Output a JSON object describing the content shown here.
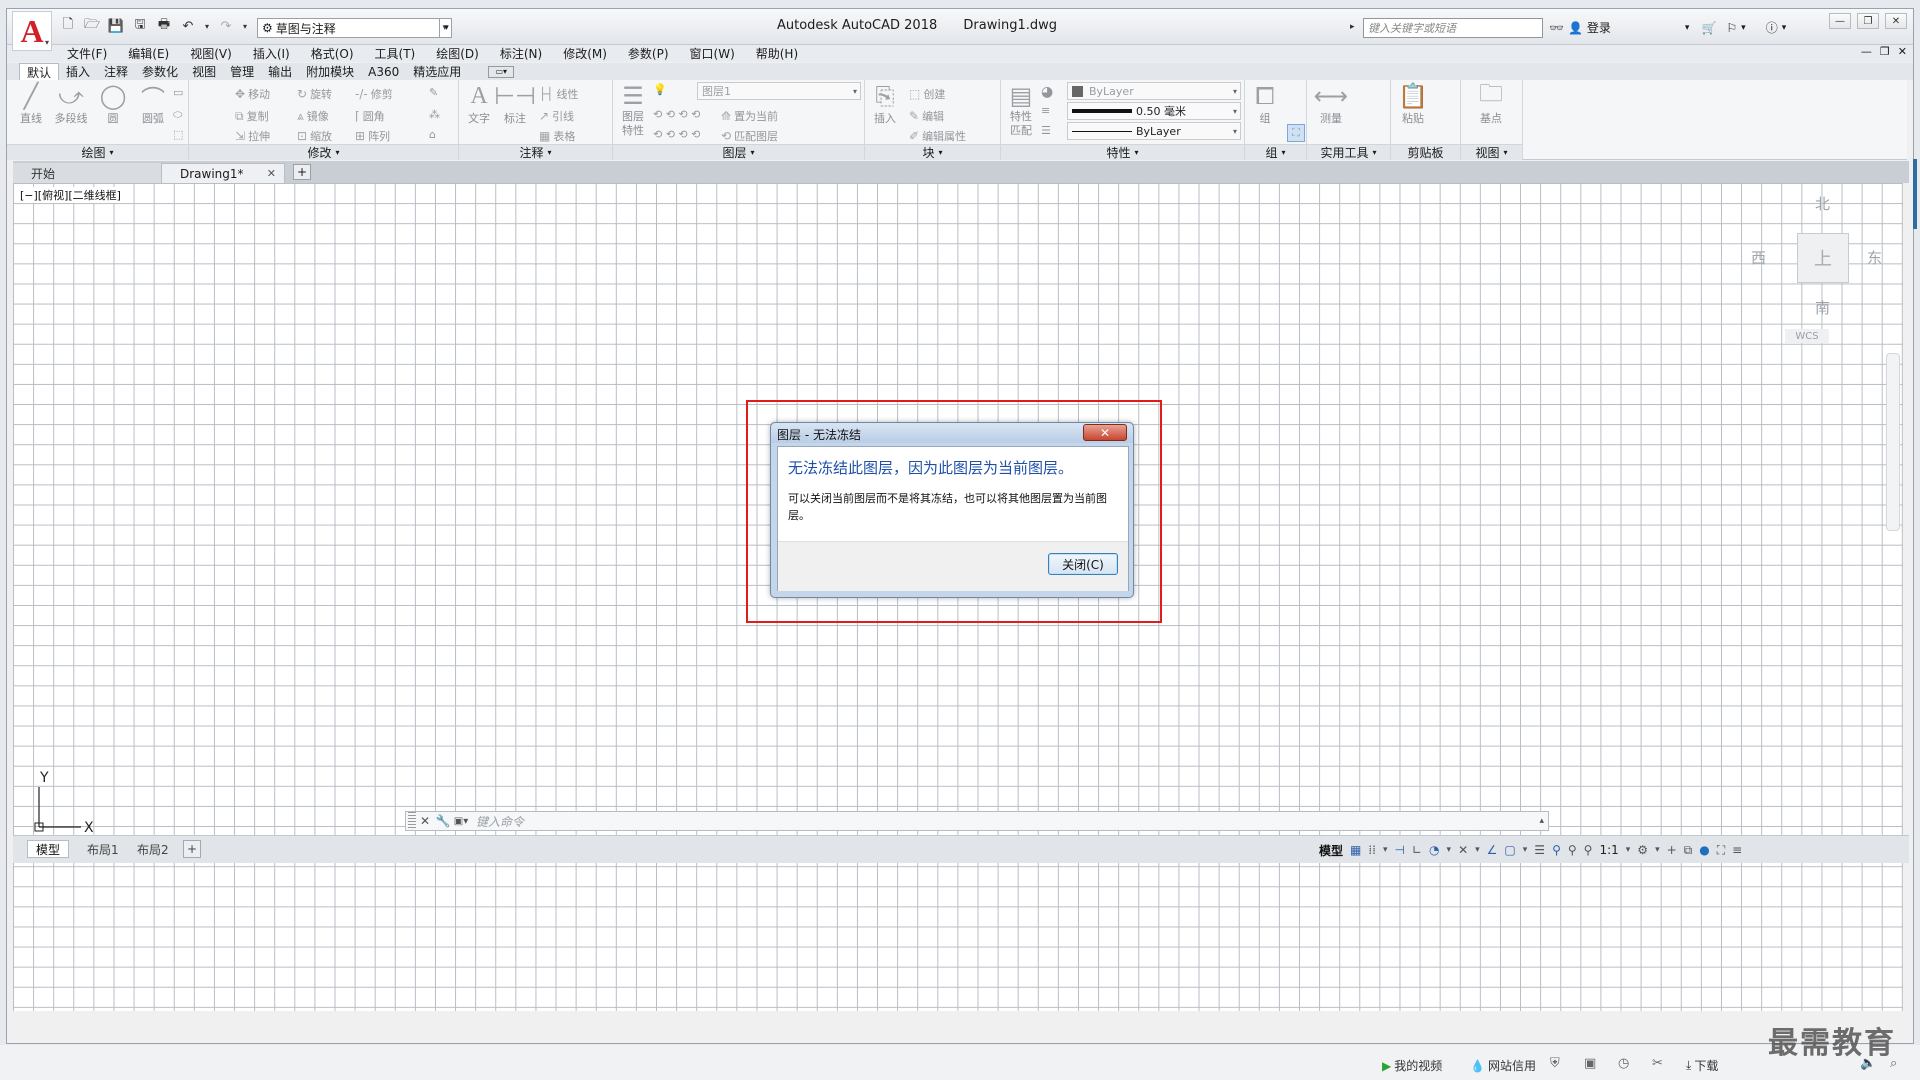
{
  "titlebar": {
    "app_name": "Autodesk AutoCAD 2018",
    "file_name": "Drawing1.dwg",
    "workspace": "草图与注释",
    "search_placeholder": "键入关键字或短语",
    "login": "登录",
    "logo_letter": "A"
  },
  "menubar": {
    "items": [
      "文件(F)",
      "编辑(E)",
      "视图(V)",
      "插入(I)",
      "格式(O)",
      "工具(T)",
      "绘图(D)",
      "标注(N)",
      "修改(M)",
      "参数(P)",
      "窗口(W)",
      "帮助(H)"
    ]
  },
  "ribbon_tabs": [
    "默认",
    "插入",
    "注释",
    "参数化",
    "视图",
    "管理",
    "输出",
    "附加模块",
    "A360",
    "精选应用"
  ],
  "ribbon": {
    "draw": {
      "title": "绘图",
      "tools": [
        "直线",
        "多段线",
        "圆",
        "圆弧"
      ]
    },
    "modify": {
      "title": "修改",
      "tools": [
        "移动",
        "旋转",
        "修剪",
        "复制",
        "镜像",
        "圆角",
        "拉伸",
        "缩放",
        "阵列"
      ]
    },
    "annotation": {
      "title": "注释",
      "tools": [
        "文字",
        "标注",
        "线性",
        "引线",
        "表格"
      ]
    },
    "layers": {
      "title": "图层",
      "properties_label": "图层特性",
      "current_layer": "图层1",
      "tools": [
        "置为当前",
        "匹配图层"
      ]
    },
    "block": {
      "title": "块",
      "tools": [
        "插入",
        "创建",
        "编辑",
        "编辑属性"
      ]
    },
    "properties": {
      "title": "特性",
      "match_label": "特性匹配",
      "color": "ByLayer",
      "lineweight": "0.50 毫米",
      "linetype": "ByLayer"
    },
    "groups": {
      "title": "组",
      "tool": "组"
    },
    "utilities": {
      "title": "实用工具",
      "tool": "测量"
    },
    "clipboard": {
      "title": "剪贴板",
      "tool": "粘贴"
    },
    "view": {
      "title": "视图",
      "tool": "基点"
    }
  },
  "doc_tabs": {
    "start": "开始",
    "drawing": "Drawing1*"
  },
  "canvas": {
    "view_label": "[−][俯视][二维线框]",
    "viewcube": {
      "north": "北",
      "south": "南",
      "east": "东",
      "west": "西",
      "top": "上",
      "wcs": "WCS"
    },
    "ucs": {
      "x": "X",
      "y": "Y"
    }
  },
  "command_line": {
    "placeholder": "键入命令"
  },
  "layout_tabs": [
    "模型",
    "布局1",
    "布局2"
  ],
  "status_bar": {
    "mode": "模型",
    "scale": "1:1"
  },
  "dialog": {
    "title": "图层 - 无法冻结",
    "main_message": "无法冻结此图层，因为此图层为当前图层。",
    "sub_message": "可以关闭当前图层而不是将其冻结，也可以将其他图层置为当前图层。",
    "close_button": "关闭(C)"
  },
  "footer": {
    "my_video": "我的视频",
    "net_credit": "网站信用",
    "download": "下载",
    "watermark": "最需教育"
  },
  "colors": {
    "highlight": "#e01c1c",
    "dialog_heading": "#1f4fa8",
    "logo": "#d31f2a"
  }
}
